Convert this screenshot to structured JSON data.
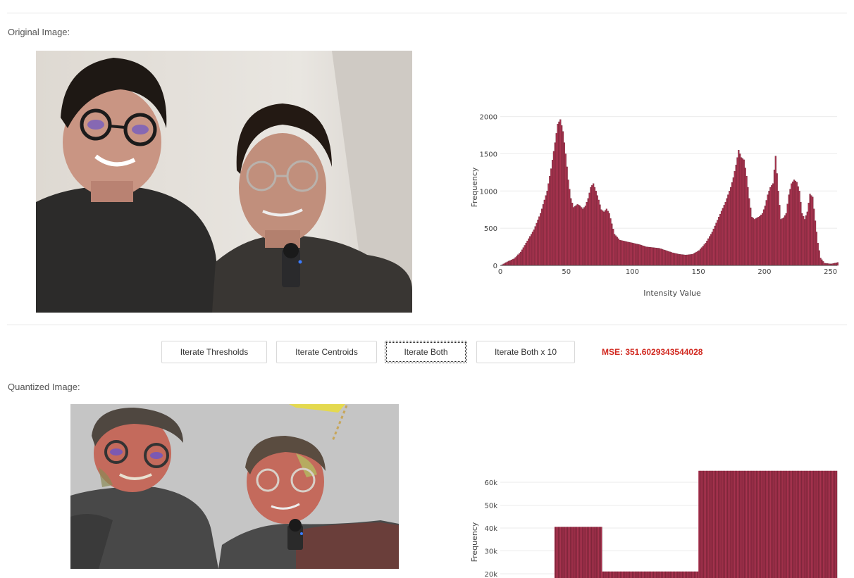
{
  "sections": {
    "original_label": "Original Image:",
    "quantized_label": "Quantized Image:"
  },
  "controls": {
    "iterate_thresholds": "Iterate Thresholds",
    "iterate_centroids": "Iterate Centroids",
    "iterate_both": "Iterate Both",
    "iterate_both_x10": "Iterate Both x 10",
    "mse_label": "MSE: 351.6029343544028"
  },
  "colors": {
    "bar_fill": "#a8334f",
    "bar_edge": "#5a1a28",
    "mse_text": "#d1281f",
    "quant_bg": "#c5c5c5",
    "quant_shirt": "#4a4a4a",
    "quant_skin": "#c46a5c"
  },
  "chart_data": [
    {
      "type": "bar",
      "name_hint": "original-histogram",
      "xlabel": "Intensity Value",
      "ylabel": "Frequency",
      "xlim": [
        0,
        255
      ],
      "ylim": [
        0,
        2100
      ],
      "xticks": [
        0,
        50,
        100,
        150,
        200,
        250
      ],
      "yticks": [
        0,
        500,
        1000,
        1500,
        2000
      ],
      "ytick_labels": [
        "0",
        "500",
        "1000",
        "1500",
        "2000"
      ],
      "x": [
        0,
        5,
        10,
        15,
        20,
        25,
        30,
        35,
        38,
        41,
        43,
        45,
        47,
        49,
        51,
        53,
        55,
        58,
        60,
        62,
        64,
        66,
        68,
        70,
        72,
        74,
        76,
        78,
        80,
        82,
        84,
        86,
        88,
        90,
        95,
        100,
        105,
        110,
        115,
        120,
        125,
        130,
        135,
        140,
        145,
        150,
        155,
        160,
        165,
        170,
        172,
        174,
        176,
        178,
        180,
        182,
        184,
        186,
        188,
        190,
        192,
        194,
        196,
        198,
        200,
        202,
        204,
        206,
        208,
        210,
        212,
        214,
        216,
        218,
        220,
        222,
        224,
        226,
        228,
        230,
        232,
        234,
        236,
        238,
        240,
        242,
        245,
        250,
        255
      ],
      "y": [
        0,
        50,
        90,
        180,
        330,
        480,
        700,
        1000,
        1300,
        1650,
        1900,
        1960,
        1800,
        1500,
        1150,
        900,
        780,
        820,
        800,
        760,
        800,
        900,
        1050,
        1100,
        1000,
        880,
        750,
        720,
        760,
        700,
        560,
        420,
        380,
        340,
        320,
        300,
        280,
        250,
        240,
        230,
        200,
        170,
        150,
        140,
        150,
        200,
        300,
        450,
        650,
        850,
        950,
        1050,
        1180,
        1350,
        1550,
        1450,
        1420,
        1200,
        900,
        650,
        620,
        640,
        660,
        700,
        800,
        950,
        1050,
        1100,
        1470,
        1000,
        620,
        640,
        700,
        950,
        1100,
        1150,
        1120,
        1000,
        700,
        620,
        720,
        960,
        920,
        600,
        300,
        100,
        30,
        20,
        40
      ]
    },
    {
      "type": "bar",
      "name_hint": "quantized-histogram",
      "xlabel": "",
      "ylabel": "Frequency",
      "xlim": [
        0,
        255
      ],
      "ylim": [
        0,
        70000
      ],
      "yticks": [
        20000,
        30000,
        40000,
        50000,
        60000
      ],
      "ytick_labels": [
        "20k",
        "30k",
        "40k",
        "50k",
        "60k"
      ],
      "bins": [
        {
          "x0": 41,
          "x1": 77,
          "value": 40500
        },
        {
          "x0": 77,
          "x1": 150,
          "value": 21000
        },
        {
          "x0": 150,
          "x1": 255,
          "value": 65000
        }
      ]
    }
  ]
}
